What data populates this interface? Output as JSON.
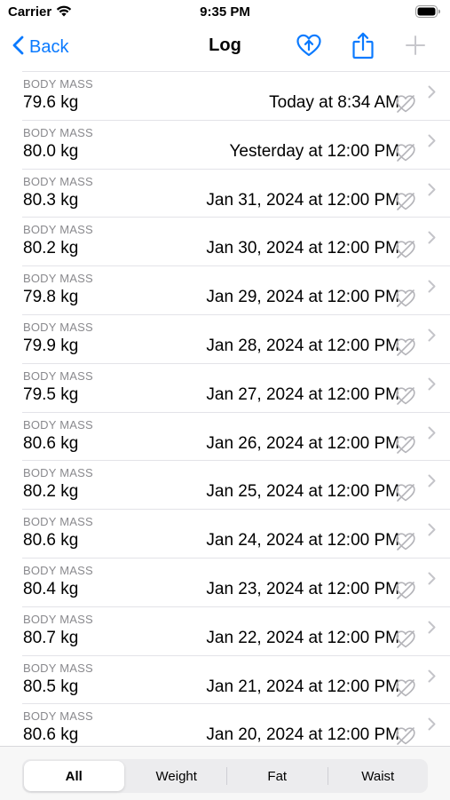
{
  "status_bar": {
    "carrier": "Carrier",
    "time": "9:35 PM",
    "wifi_icon": "wifi-icon",
    "battery_icon": "battery-icon"
  },
  "nav": {
    "back_label": "Back",
    "title": "Log",
    "accent_color": "#0a7aff",
    "disabled_color": "#c7c7cc"
  },
  "entries": [
    {
      "category": "BODY MASS",
      "value": "79.6 kg",
      "date": "Today at 8:34 AM"
    },
    {
      "category": "BODY MASS",
      "value": "80.0 kg",
      "date": "Yesterday at 12:00 PM"
    },
    {
      "category": "BODY MASS",
      "value": "80.3 kg",
      "date": "Jan 31, 2024 at 12:00 PM"
    },
    {
      "category": "BODY MASS",
      "value": "80.2 kg",
      "date": "Jan 30, 2024 at 12:00 PM"
    },
    {
      "category": "BODY MASS",
      "value": "79.8 kg",
      "date": "Jan 29, 2024 at 12:00 PM"
    },
    {
      "category": "BODY MASS",
      "value": "79.9 kg",
      "date": "Jan 28, 2024 at 12:00 PM"
    },
    {
      "category": "BODY MASS",
      "value": "79.5 kg",
      "date": "Jan 27, 2024 at 12:00 PM"
    },
    {
      "category": "BODY MASS",
      "value": "80.6 kg",
      "date": "Jan 26, 2024 at 12:00 PM"
    },
    {
      "category": "BODY MASS",
      "value": "80.2 kg",
      "date": "Jan 25, 2024 at 12:00 PM"
    },
    {
      "category": "BODY MASS",
      "value": "80.6 kg",
      "date": "Jan 24, 2024 at 12:00 PM"
    },
    {
      "category": "BODY MASS",
      "value": "80.4 kg",
      "date": "Jan 23, 2024 at 12:00 PM"
    },
    {
      "category": "BODY MASS",
      "value": "80.7 kg",
      "date": "Jan 22, 2024 at 12:00 PM"
    },
    {
      "category": "BODY MASS",
      "value": "80.5 kg",
      "date": "Jan 21, 2024 at 12:00 PM"
    },
    {
      "category": "BODY MASS",
      "value": "80.6 kg",
      "date": "Jan 20, 2024 at 12:00 PM"
    }
  ],
  "filter": {
    "segments": [
      "All",
      "Weight",
      "Fat",
      "Waist"
    ],
    "selected": "All"
  }
}
